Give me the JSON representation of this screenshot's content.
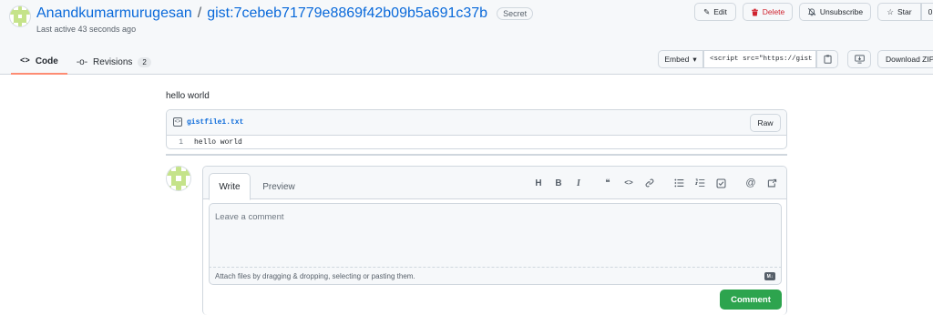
{
  "header": {
    "owner": "Anandkumarmurugesan",
    "separator": "/",
    "gist_name": "gist:7cebeb71779e8869f42b09b5a691c37b",
    "badge": "Secret",
    "last_active": "Last active 43 seconds ago",
    "buttons": {
      "edit": "Edit",
      "delete": "Delete",
      "unsubscribe": "Unsubscribe",
      "star": "Star",
      "star_count": "0"
    }
  },
  "tabs": [
    {
      "label": "Code",
      "icon": "code-icon"
    },
    {
      "label": "Revisions",
      "icon": "git-commit-icon",
      "count": "2"
    }
  ],
  "embed": {
    "label": "Embed",
    "value": "<script src=\"https://gist",
    "download": "Download ZIP"
  },
  "gist": {
    "description": "hello world",
    "file_name": "gistfile1.txt",
    "raw": "Raw",
    "lines": [
      {
        "number": "1",
        "code": "hello world"
      }
    ]
  },
  "comment": {
    "write_tab": "Write",
    "preview_tab": "Preview",
    "placeholder": "Leave a comment",
    "attach_hint": "Attach files by dragging & dropping, selecting or pasting them.",
    "markdown_badge": "M↓",
    "submit": "Comment",
    "toolbar": [
      "heading-icon",
      "bold-icon",
      "italic-icon",
      "quote-icon",
      "code-icon",
      "link-icon",
      "bullet-list-icon",
      "numbered-list-icon",
      "task-list-icon",
      "mention-icon",
      "reference-icon"
    ]
  },
  "colors": {
    "accent": "#0969da",
    "primary_button": "#2da44e",
    "danger": "#cf222e",
    "tab_underline": "#fd8c73"
  }
}
